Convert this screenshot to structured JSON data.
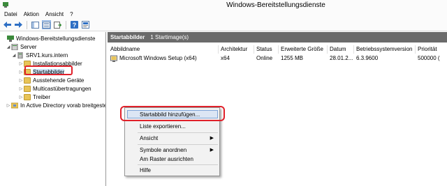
{
  "window": {
    "title": "Windows-Bereitstellungsdienste"
  },
  "menu": {
    "items": [
      "Datei",
      "Aktion",
      "Ansicht",
      "?"
    ]
  },
  "tree": {
    "root": "Windows-Bereitstellungsdienste",
    "servers": "Server",
    "server": "SRV1.kurs.intern",
    "children": [
      "Installationsabbilder",
      "Startabbilder",
      "Ausstehende Geräte",
      "Multicastübertragungen",
      "Treiber"
    ],
    "ad": "In Active Directory vorab breitgestellt",
    "selected": "Startabbilder"
  },
  "content": {
    "header_title": "Startabbilder",
    "header_count": "1 Startimage(s)",
    "columns": [
      "Abbildname",
      "Architektur",
      "Status",
      "Erweiterte Größe",
      "Datum",
      "Betriebssystemversion",
      "Priorität"
    ],
    "rows": [
      {
        "name": "Microsoft Windows Setup (x64)",
        "arch": "x64",
        "status": "Online",
        "size": "1255 MB",
        "date": "28.01.2...",
        "os_version": "6.3.9600",
        "priority": "500000 ("
      }
    ]
  },
  "context_menu": {
    "items": [
      "Startabbild hinzufügen...",
      "Liste exportieren...",
      "Ansicht",
      "Symbole anordnen",
      "Am Raster ausrichten",
      "Hilfe"
    ]
  },
  "colors": {
    "highlight_ring": "#e0202a",
    "header_bg": "#6b6b6b",
    "folder": "#e8c458"
  }
}
